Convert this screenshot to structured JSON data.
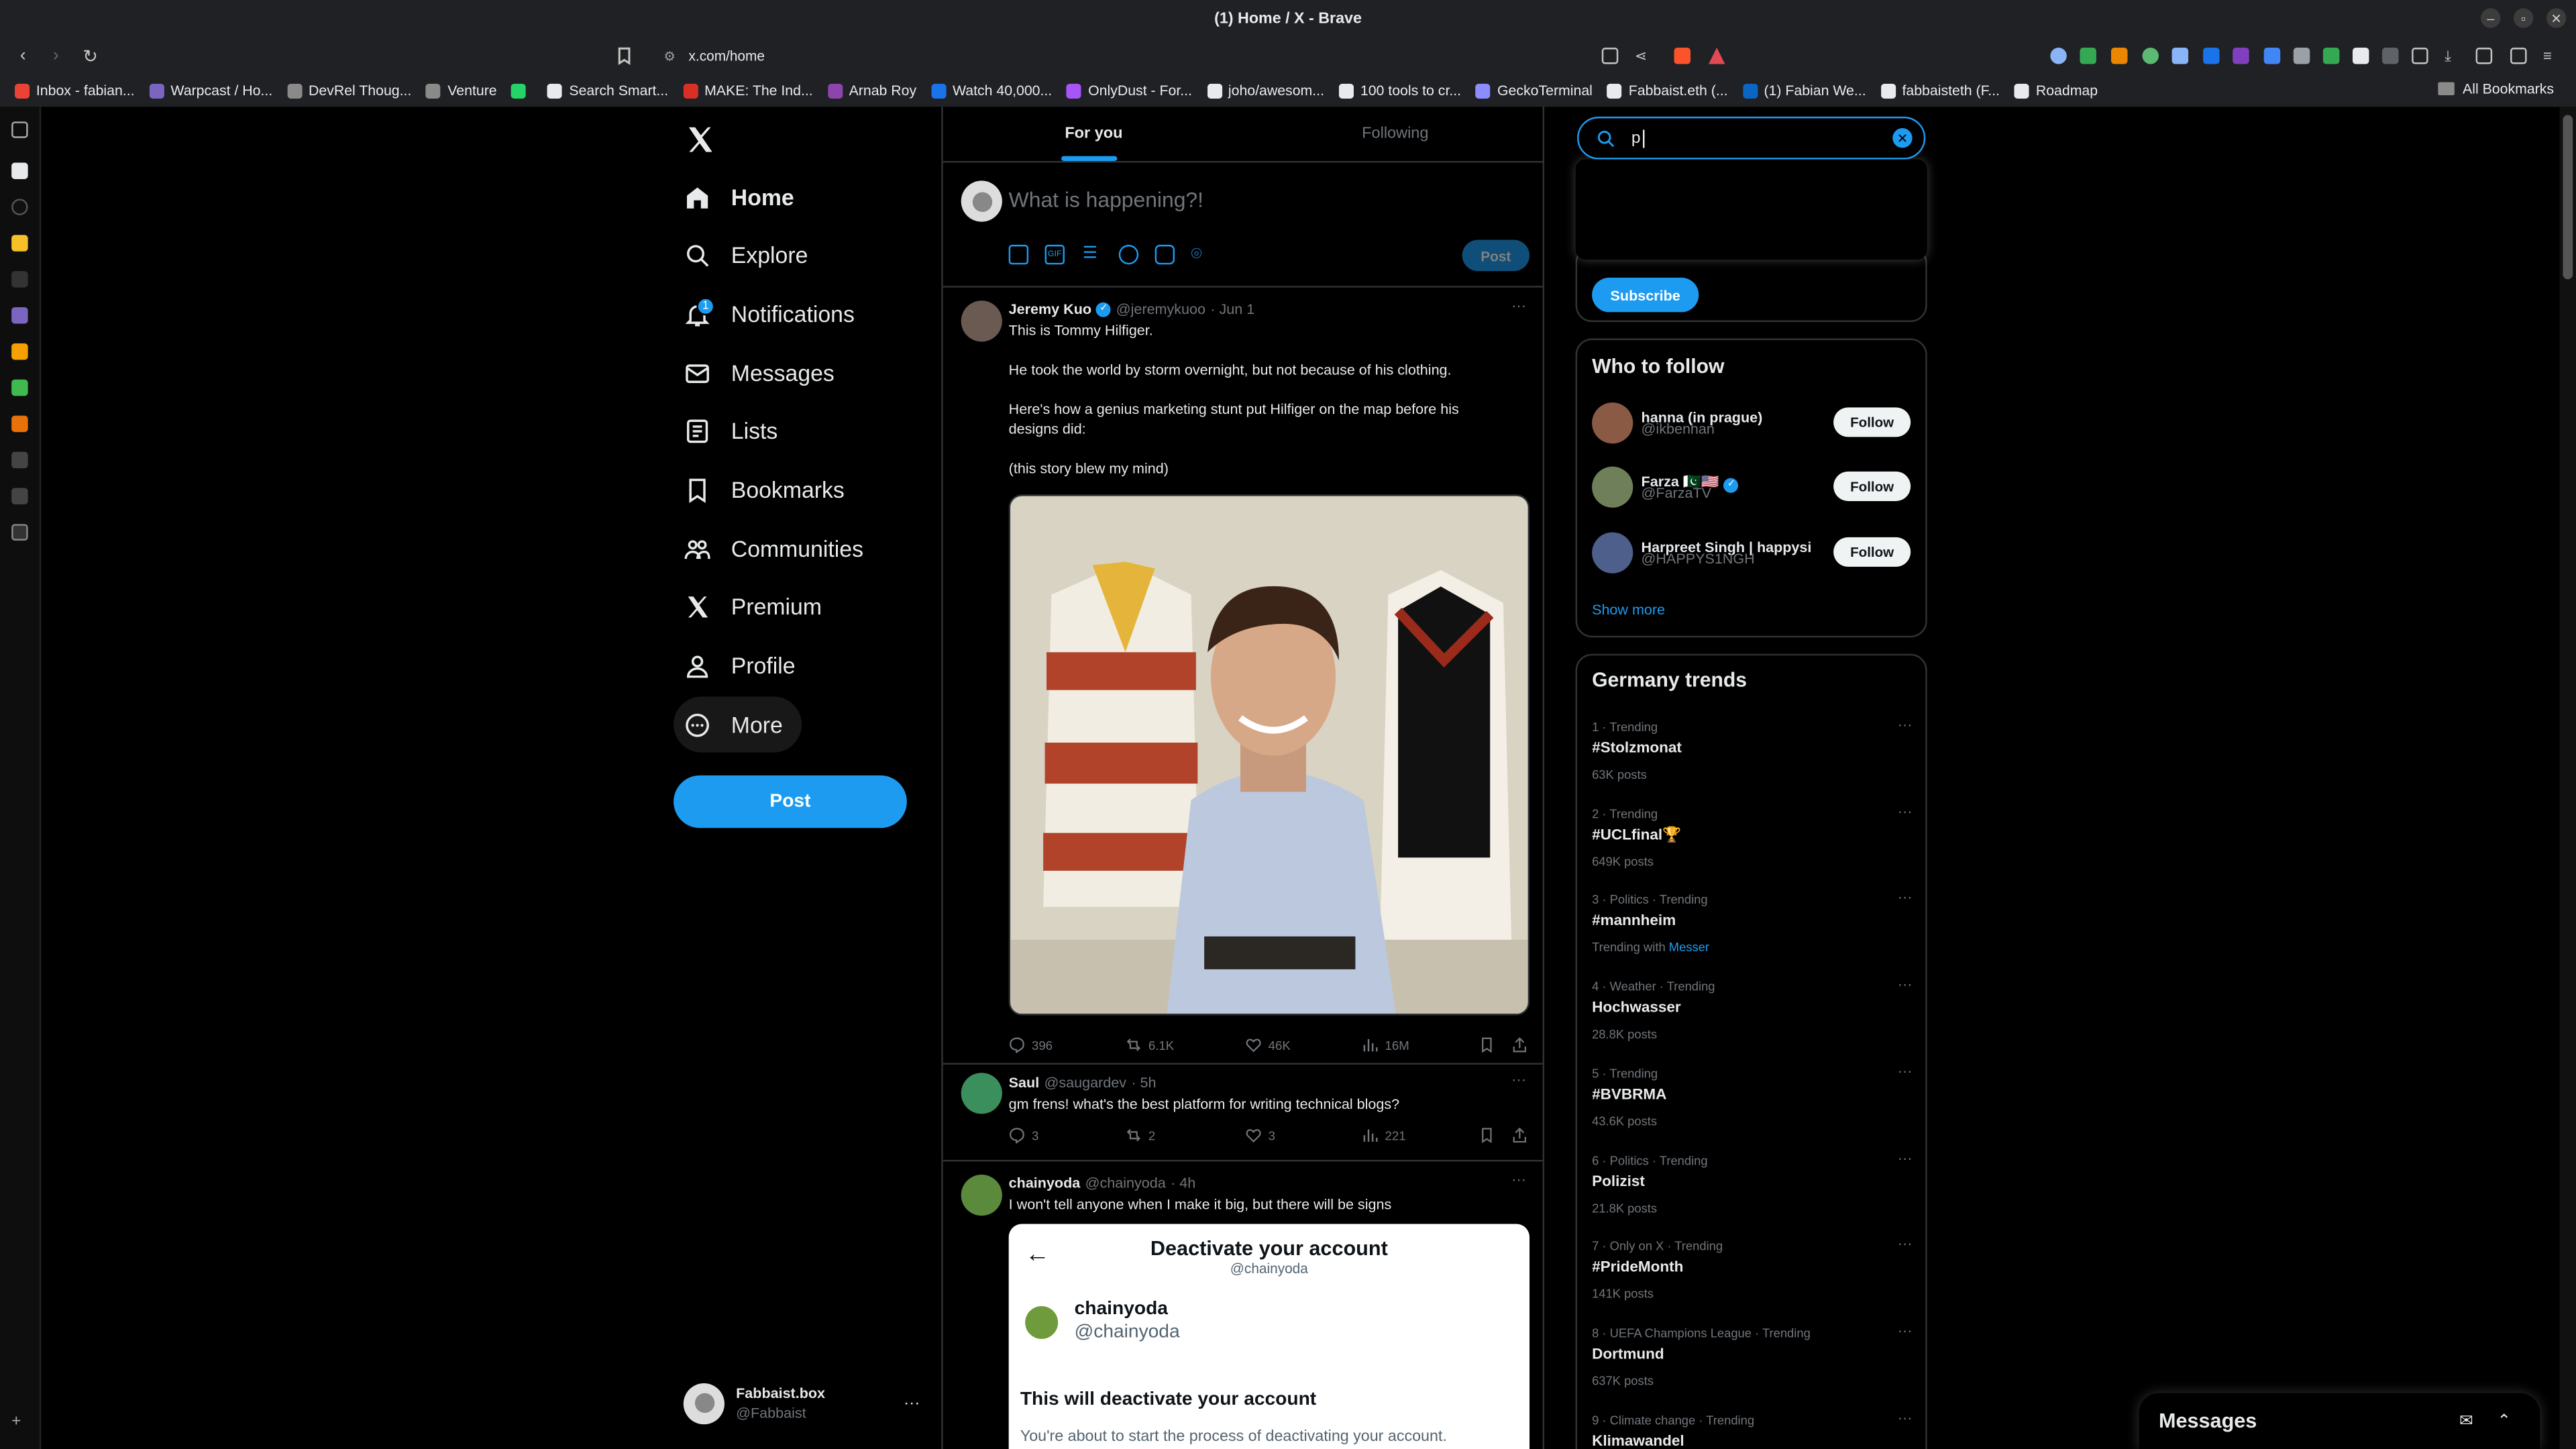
{
  "window": {
    "title": "(1) Home / X - Brave"
  },
  "browser": {
    "url": "x.com/home",
    "bookmarks": [
      {
        "label": "Inbox - fabian...",
        "color": "#ea4335"
      },
      {
        "label": "Warpcast / Ho...",
        "color": "#7c65c1"
      },
      {
        "label": "DevRel Thoug...",
        "color": "#8a8a8a"
      },
      {
        "label": "Venture",
        "color": "#8a8a8a"
      },
      {
        "label": "",
        "color": "#25d366"
      },
      {
        "label": "Search Smart...",
        "color": "#e8eaed"
      },
      {
        "label": "MAKE: The Ind...",
        "color": "#d93025"
      },
      {
        "label": "Arnab Roy",
        "color": "#8e44ad"
      },
      {
        "label": "Watch 40,000...",
        "color": "#1a73e8"
      },
      {
        "label": "OnlyDust - For...",
        "color": "#a855f7"
      },
      {
        "label": "joho/awesom...",
        "color": "#e8eaed"
      },
      {
        "label": "100 tools to cr...",
        "color": "#e8eaed"
      },
      {
        "label": "GeckoTerminal",
        "color": "#8c8cff"
      },
      {
        "label": "Fabbaist.eth (...",
        "color": "#e8eaed"
      },
      {
        "label": "(1) Fabian We...",
        "color": "#0a66c2"
      },
      {
        "label": "fabbaisteth (F...",
        "color": "#e8eaed"
      },
      {
        "label": "Roadmap",
        "color": "#e8eaed"
      }
    ],
    "all_bookmarks": "All Bookmarks"
  },
  "nav": {
    "items": [
      {
        "label": "Home",
        "icon": "home-icon"
      },
      {
        "label": "Explore",
        "icon": "search-icon"
      },
      {
        "label": "Notifications",
        "icon": "bell-icon",
        "badge": "1"
      },
      {
        "label": "Messages",
        "icon": "envelope-icon"
      },
      {
        "label": "Lists",
        "icon": "list-icon"
      },
      {
        "label": "Bookmarks",
        "icon": "bookmark-icon"
      },
      {
        "label": "Communities",
        "icon": "people-icon"
      },
      {
        "label": "Premium",
        "icon": "x-logo-icon"
      },
      {
        "label": "Profile",
        "icon": "person-icon"
      },
      {
        "label": "More",
        "icon": "more-circle-icon"
      }
    ],
    "post_button": "Post",
    "account": {
      "name": "Fabbaist.box",
      "handle": "@Fabbaist"
    }
  },
  "timeline": {
    "tabs": [
      "For you",
      "Following"
    ],
    "composer": {
      "placeholder": "What is happening?!",
      "post": "Post"
    },
    "tweets": [
      {
        "name": "Jeremy Kuo",
        "handle": "@jeremykuoo",
        "time": "· Jun 1",
        "verified": true,
        "lines": [
          "This is Tommy Hilfiger.",
          "He took the world by storm overnight, but not because of his clothing.",
          "Here's how a genius marketing stunt put Hilfiger on the map before his designs did:",
          "(this story blew my mind)"
        ],
        "stats": {
          "replies": "396",
          "reposts": "6.1K",
          "likes": "46K",
          "views": "16M"
        }
      },
      {
        "name": "Saul",
        "handle": "@saugardev",
        "time": "· 5h",
        "lines": [
          "gm frens! what's the best platform for writing technical blogs?"
        ],
        "stats": {
          "replies": "3",
          "reposts": "2",
          "likes": "3",
          "views": "221"
        }
      },
      {
        "name": "chainyoda",
        "handle": "@chainyoda",
        "time": "· 4h",
        "lines": [
          "I won't tell anyone when I make it big, but there will be signs"
        ],
        "embed": {
          "title": "Deactivate your account",
          "subtitle": "@chainyoda",
          "name": "chainyoda",
          "handle": "@chainyoda",
          "heading": "This will deactivate your account",
          "body": "You're about to start the process of deactivating your account."
        }
      }
    ]
  },
  "search": {
    "value": "p"
  },
  "subscribe_button": "Subscribe",
  "who_to_follow": {
    "title": "Who to follow",
    "users": [
      {
        "name": "hanna (in prague)",
        "handle": "@ikbenhan",
        "button": "Follow"
      },
      {
        "name": "Farza 🇵🇰🇺🇸",
        "handle": "@FarzaTV",
        "button": "Follow",
        "verified": true
      },
      {
        "name": "Harpreet Singh | happysi",
        "handle": "@HAPPYS1NGH",
        "button": "Follow"
      }
    ],
    "show_more": "Show more"
  },
  "trends": {
    "title": "Germany trends",
    "items": [
      {
        "meta": "1 · Trending",
        "name": "#Stolzmonat",
        "posts": "63K posts"
      },
      {
        "meta": "2 · Trending",
        "name": "#UCLfinal🏆",
        "posts": "649K posts"
      },
      {
        "meta": "3 · Politics · Trending",
        "name": "#mannheim",
        "posts": "Trending with",
        "with": "Messer"
      },
      {
        "meta": "4 · Weather · Trending",
        "name": "Hochwasser",
        "posts": "28.8K posts"
      },
      {
        "meta": "5 · Trending",
        "name": "#BVBRMA",
        "posts": "43.6K posts"
      },
      {
        "meta": "6 · Politics · Trending",
        "name": "Polizist",
        "posts": "21.8K posts"
      },
      {
        "meta": "7 · Only on X · Trending",
        "name": "#PrideMonth",
        "posts": "141K posts"
      },
      {
        "meta": "8 · UEFA Champions League · Trending",
        "name": "Dortmund",
        "posts": "637K posts"
      },
      {
        "meta": "9 · Climate change · Trending",
        "name": "Klimawandel",
        "posts": ""
      }
    ]
  },
  "messages_drawer": {
    "title": "Messages"
  },
  "colors": {
    "accent": "#1d9bf0",
    "background": "#000000",
    "border": "#2f3336"
  }
}
